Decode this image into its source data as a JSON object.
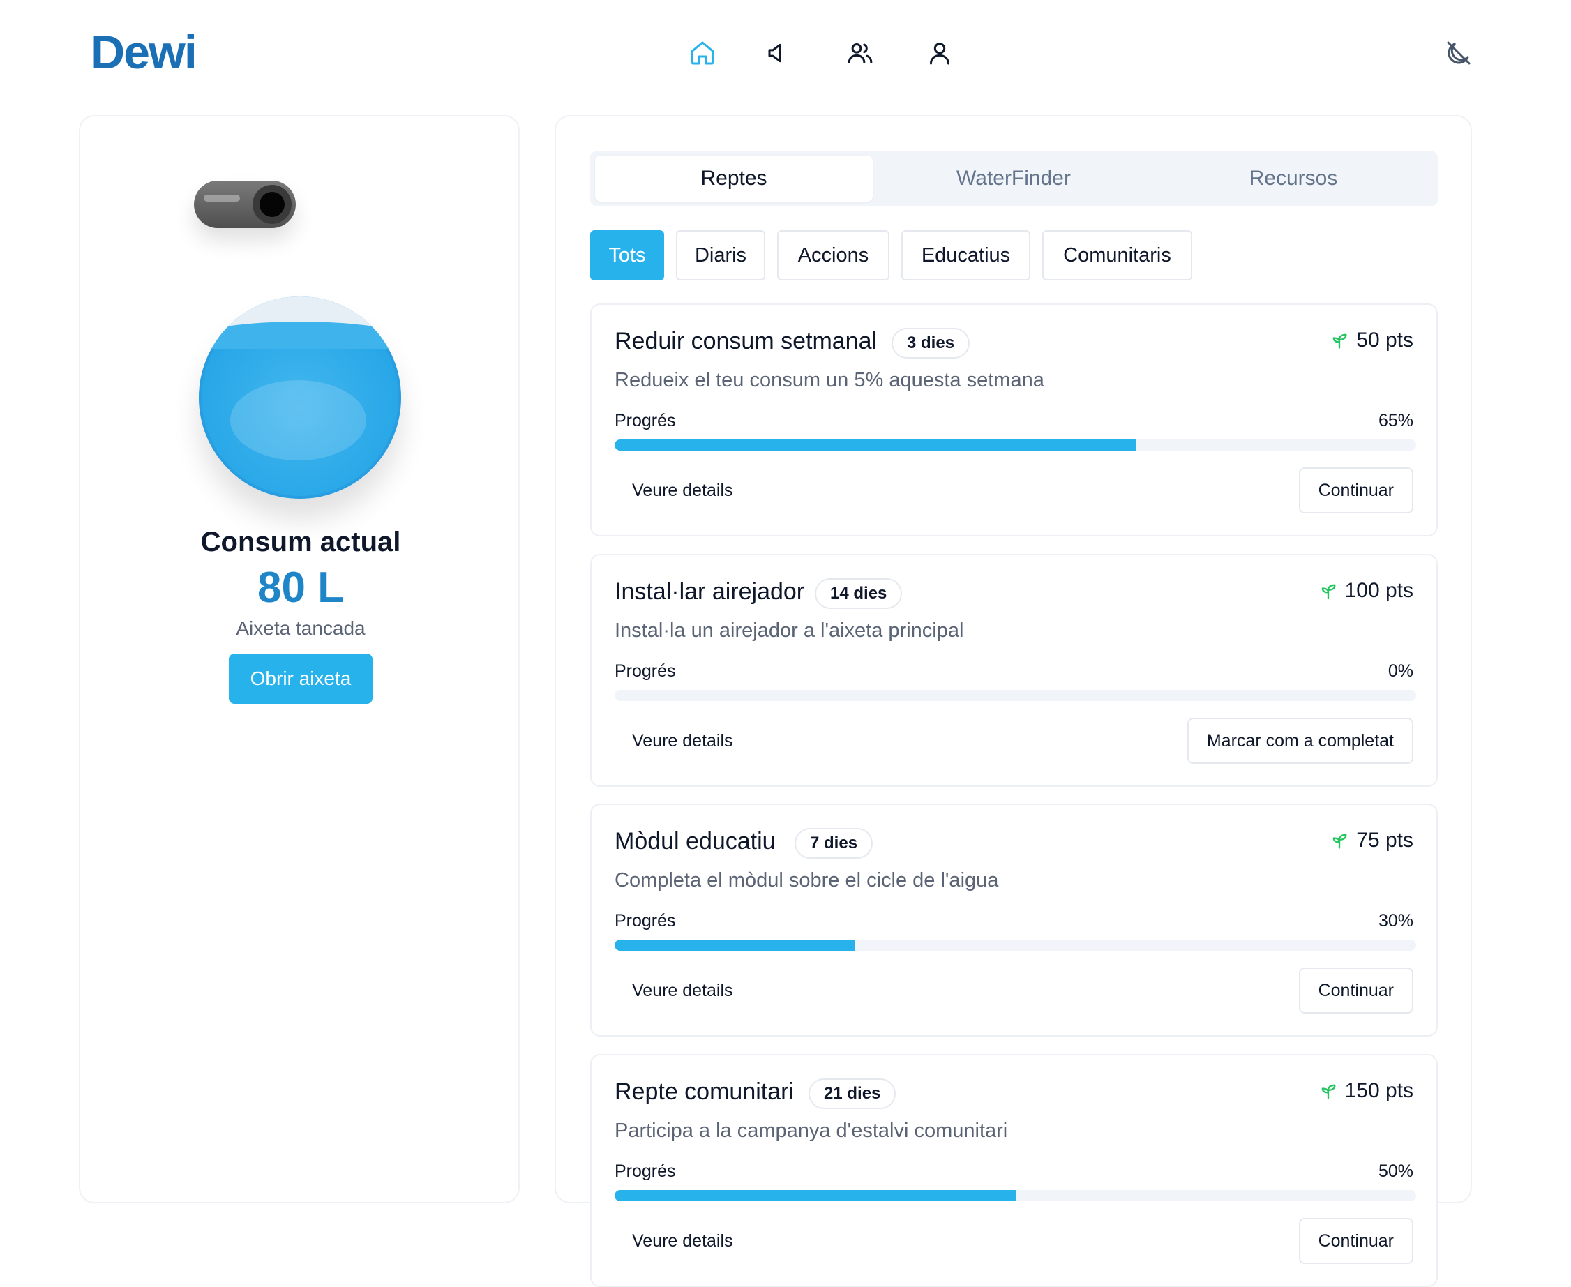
{
  "header": {
    "logo": "Dewi",
    "nav": [
      {
        "icon": "home-icon",
        "active": true
      },
      {
        "icon": "speaker-icon",
        "active": false
      },
      {
        "icon": "users-icon",
        "active": false
      },
      {
        "icon": "user-icon",
        "active": false
      }
    ],
    "theme_icon": "moon-off-icon"
  },
  "consumption": {
    "tap_toggle_state": "off",
    "title": "Consum actual",
    "value": "80 L",
    "status": "Aixeta tancada",
    "button_label": "Obrir aixeta"
  },
  "tabs": [
    {
      "label": "Reptes",
      "active": true
    },
    {
      "label": "WaterFinder",
      "active": false
    },
    {
      "label": "Recursos",
      "active": false
    }
  ],
  "filters": [
    {
      "label": "Tots",
      "active": true
    },
    {
      "label": "Diaris",
      "active": false
    },
    {
      "label": "Accions",
      "active": false
    },
    {
      "label": "Educatius",
      "active": false
    },
    {
      "label": "Comunitaris",
      "active": false
    }
  ],
  "progress_label": "Progrés",
  "details_label": "Veure details",
  "challenges": [
    {
      "title": "Reduir consum setmanal",
      "days": "3 dies",
      "points": "50 pts",
      "description": "Redueix el teu consum un 5% aquesta setmana",
      "progress": 65,
      "progress_text": "65%",
      "action": "Continuar"
    },
    {
      "title": "Instal·lar airejador",
      "days": "14 dies",
      "points": "100 pts",
      "description": "Instal·la un airejador a l'aixeta principal",
      "progress": 0,
      "progress_text": "0%",
      "action": "Marcar com a completat"
    },
    {
      "title": "Mòdul educatiu",
      "days": "7 dies",
      "points": "75 pts",
      "description": "Completa el mòdul sobre el cicle de l'aigua",
      "progress": 30,
      "progress_text": "30%",
      "action": "Continuar"
    },
    {
      "title": "Repte comunitari",
      "days": "21 dies",
      "points": "150 pts",
      "description": "Participa a la campanya d'estalvi comunitari",
      "progress": 50,
      "progress_text": "50%",
      "action": "Continuar"
    }
  ],
  "colors": {
    "accent": "#27b2ec",
    "brand": "#1b6fb5",
    "points_icon": "#22c55e"
  }
}
